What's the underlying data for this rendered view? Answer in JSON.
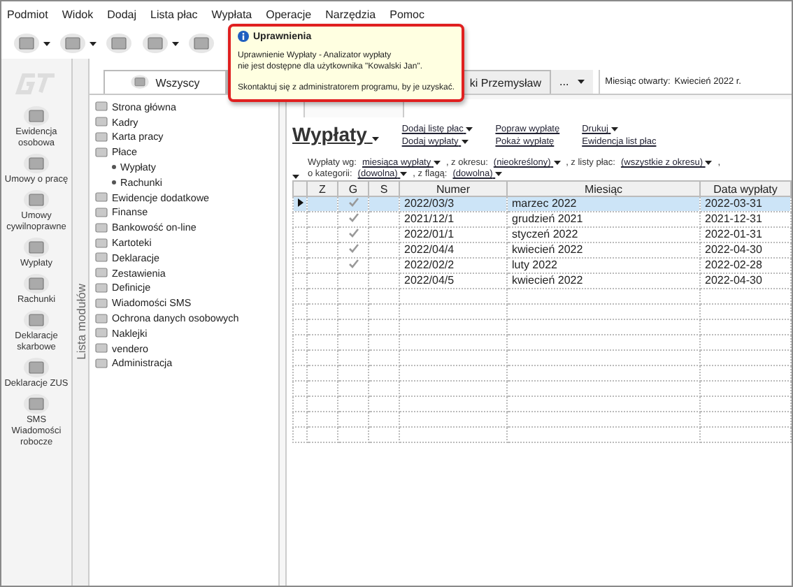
{
  "menu": [
    "Podmiot",
    "Widok",
    "Dodaj",
    "Lista płac",
    "Wypłata",
    "Operacje",
    "Narzędzia",
    "Pomoc"
  ],
  "toolbar": [
    {
      "caret": true
    },
    {
      "caret": true
    },
    {
      "caret": false
    },
    {
      "caret": true
    },
    {
      "caret": false
    }
  ],
  "modules": [
    {
      "label": "Ewidencja osobowa"
    },
    {
      "label": "Umowy o pracę"
    },
    {
      "label": "Umowy cywilnoprawne"
    },
    {
      "label": "Wypłaty"
    },
    {
      "label": "Rachunki"
    },
    {
      "label": "Deklaracje skarbowe"
    },
    {
      "label": "Deklaracje ZUS"
    },
    {
      "label": "SMS Wiadomości robocze"
    }
  ],
  "modules_strip": "Lista modułów",
  "tabs": [
    {
      "label": "Wszyscy",
      "selected": true
    },
    {
      "label": "ki Przemysław",
      "selected": false
    }
  ],
  "tab_more": "...",
  "open_month": {
    "label": "Miesiąc otwarty:",
    "value": "Kwiecień 2022 r."
  },
  "tree": [
    {
      "label": "Strona główna"
    },
    {
      "label": "Kadry"
    },
    {
      "label": "Karta pracy"
    },
    {
      "label": "Płace",
      "children": [
        {
          "label": "Wypłaty"
        },
        {
          "label": "Rachunki"
        }
      ]
    },
    {
      "label": "Ewidencje dodatkowe"
    },
    {
      "label": "Finanse"
    },
    {
      "label": "Bankowość on-line"
    },
    {
      "label": "Kartoteki"
    },
    {
      "label": "Deklaracje"
    },
    {
      "label": "Zestawienia"
    },
    {
      "label": "Definicje"
    },
    {
      "label": "Wiadomości SMS"
    },
    {
      "label": "Ochrona danych osobowych"
    },
    {
      "label": "Naklejki"
    },
    {
      "label": "vendero"
    },
    {
      "label": "Administracja"
    }
  ],
  "heading": "Wypłaty",
  "actions": [
    [
      "Dodaj listę płac",
      "Dodaj wypłaty"
    ],
    [
      "Popraw wypłatę",
      "Pokaż wypłatę"
    ],
    [
      "Drukuj",
      "Ewidencja list płac"
    ]
  ],
  "action_carets": [
    [
      true,
      true
    ],
    [
      false,
      false
    ],
    [
      true,
      false
    ]
  ],
  "filters": [
    [
      {
        "label": "Wypłaty wg:",
        "value": "miesiąca wypłaty"
      },
      {
        "label": ", z okresu:",
        "value": "(nieokreślony)"
      },
      {
        "label": ", z listy płac:",
        "value": "(wszystkie z okresu)"
      },
      {
        "label": ","
      }
    ],
    [
      {
        "label": "o kategorii:",
        "value": "(dowolna)"
      },
      {
        "label": ", z flagą:",
        "value": "(dowolna)"
      }
    ]
  ],
  "table": {
    "columns": [
      "Z",
      "G",
      "S",
      "Numer",
      "Miesiąc",
      "Data wypłaty"
    ],
    "rows": [
      {
        "selected": true,
        "g_checked": true,
        "numer": "2022/03/3",
        "miesiac": "marzec 2022",
        "data": "2022-03-31"
      },
      {
        "selected": false,
        "g_checked": true,
        "numer": "2021/12/1",
        "miesiac": "grudzień 2021",
        "data": "2021-12-31"
      },
      {
        "selected": false,
        "g_checked": true,
        "numer": "2022/01/1",
        "miesiac": "styczeń 2022",
        "data": "2022-01-31"
      },
      {
        "selected": false,
        "g_checked": true,
        "numer": "2022/04/4",
        "miesiac": "kwiecień 2022",
        "data": "2022-04-30"
      },
      {
        "selected": false,
        "g_checked": true,
        "numer": "2022/02/2",
        "miesiac": "luty 2022",
        "data": "2022-02-28"
      },
      {
        "selected": false,
        "g_checked": false,
        "numer": "2022/04/5",
        "miesiac": "kwiecień 2022",
        "data": "2022-04-30"
      }
    ]
  },
  "tooltip": {
    "title": "Uprawnienia",
    "lines": [
      "Uprawnienie Wypłaty - Analizator wypłaty",
      "nie jest dostępne dla użytkownika \"Kowalski Jan\"."
    ],
    "hint": "Skontaktuj się z administratorem programu, by je uzyskać."
  }
}
